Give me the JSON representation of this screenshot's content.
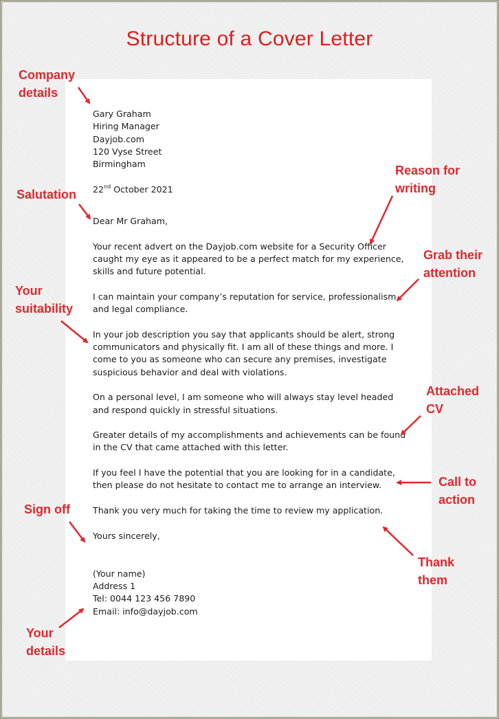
{
  "title": "Structure of a Cover Letter",
  "colors": {
    "accent": "#e3262b",
    "title": "#e01b1b",
    "text": "#1a1a1a",
    "border": "#7d7f66"
  },
  "letter": {
    "recipient": [
      "Gary Graham",
      "Hiring Manager",
      "Dayjob.com",
      "120 Vyse Street",
      "Birmingham"
    ],
    "date": {
      "day": "22",
      "suffix": "nd",
      "rest": "October 2021"
    },
    "salutation": "Dear Mr Graham,",
    "paragraphs": [
      "Your recent advert on the Dayjob.com website for a Security Officer caught my eye as it appeared to be a perfect match for my experience, skills and future potential.",
      "I can maintain your company’s reputation for service, professionalism and legal compliance.",
      "In your job description you say that applicants should be alert, strong communicators and physically fit. I am all of these things and more. I come to you as someone who can secure any premises, investigate suspicious behavior and deal with violations.",
      "On a personal level, I am someone who will always stay level headed and respond quickly in stressful situations.",
      "Greater details of my accomplishments and achievements can be found in the CV that came attached with this letter.",
      "If you feel I have the potential that you are looking for in a candidate, then please do not hesitate to contact me to arrange an interview.",
      "Thank you very much for taking the time to review my application."
    ],
    "closing": "Yours sincerely,",
    "sender": [
      "(Your name)",
      "Address 1",
      "Tel: 0044 123 456 7890",
      "Email: info@dayjob.com"
    ]
  },
  "annotations": {
    "company_details": [
      "Company",
      "details"
    ],
    "salutation": [
      "Salutation"
    ],
    "your_suitability": [
      "Your",
      "suitability"
    ],
    "sign_off": [
      "Sign off"
    ],
    "your_details": [
      "Your",
      "details"
    ],
    "reason_for_writing": [
      "Reason for",
      "writing"
    ],
    "grab_attention": [
      "Grab their",
      "attention"
    ],
    "attached_cv": [
      "Attached",
      "CV"
    ],
    "call_to_action": [
      "Call to",
      "action"
    ],
    "thank_them": [
      "Thank",
      "them"
    ]
  }
}
